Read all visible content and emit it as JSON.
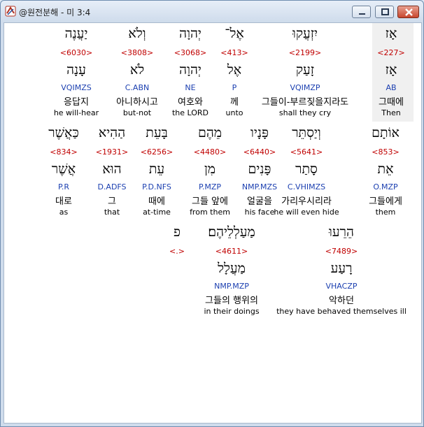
{
  "window": {
    "title": "@원전분해 - 미 3:4",
    "minimize": "minimize",
    "maximize": "maximize",
    "close": "close"
  },
  "rows": [
    {
      "words": [
        {
          "heb": "אָז",
          "strong": "<227>",
          "lemma": "אָז",
          "morph": "AB",
          "kor": "그때에",
          "eng": "Then"
        },
        {
          "heb": "יִזְעֲקוּ",
          "strong": "<2199>",
          "lemma": "זָעַק",
          "morph": "VQIMZP",
          "kor": "그들이-부르짖을지라도",
          "eng": "shall they cry"
        },
        {
          "heb": "אֶל־",
          "strong": "<413>",
          "lemma": "אֶל",
          "morph": "P",
          "kor": "께",
          "eng": "unto"
        },
        {
          "heb": "יְהוָה",
          "strong": "<3068>",
          "lemma": "יְהוָה",
          "morph": "NE",
          "kor": "여호와",
          "eng": "the LORD"
        },
        {
          "heb": "וְלֹא",
          "strong": "<3808>",
          "lemma": "לֹא",
          "morph": "C.ABN",
          "kor": "아니하시고",
          "eng": "but-not"
        },
        {
          "heb": "יַעֲנֶה",
          "strong": "<6030>",
          "lemma": "עָנָה",
          "morph": "VQIMZS",
          "kor": "응답지",
          "eng": "he will-hear"
        }
      ]
    },
    {
      "words": [
        {
          "heb": "אוֹתָם",
          "strong": "<853>",
          "lemma": "אֵת",
          "morph": "O.MZP",
          "kor": "그들에게",
          "eng": "them"
        },
        {
          "heb": "וְיַסְתֵּר",
          "strong": "<5641>",
          "lemma": "סָתַר",
          "morph": "C.VHIMZS",
          "kor": "가리우시리라",
          "eng": "he will even hide"
        },
        {
          "heb": "פָּנָיו",
          "strong": "<6440>",
          "lemma": "פָּנִים",
          "morph": "NMP.MZS",
          "kor": "얼굴을",
          "eng": "his face"
        },
        {
          "heb": "מֵהֶם",
          "strong": "<4480>",
          "lemma": "מִן",
          "morph": "P.MZP",
          "kor": "그들 앞에",
          "eng": "from them"
        },
        {
          "heb": "בָּעֵת",
          "strong": "<6256>",
          "lemma": "עֵת",
          "morph": "P.D.NFS",
          "kor": "때에",
          "eng": "at-time"
        },
        {
          "heb": "הַהִיא",
          "strong": "<1931>",
          "lemma": "הוּא",
          "morph": "D.ADFS",
          "kor": "그",
          "eng": "that"
        },
        {
          "heb": "כַּאֲשֶׁר",
          "strong": "<834>",
          "lemma": "אֲשֶׁר",
          "morph": "P.R",
          "kor": "대로",
          "eng": "as"
        }
      ]
    },
    {
      "words": [
        {
          "heb": "הֵרֵעוּ",
          "strong": "<7489>",
          "lemma": "רָעַע",
          "morph": "VHACZP",
          "kor": "악하던",
          "eng": "they have behaved themselves ill"
        },
        {
          "heb": "מַעַלְלֵיהֶם׃",
          "strong": "<4611>",
          "lemma": "מַעֲלָל",
          "morph": "NMP.MZP",
          "kor": "그들의 행위의",
          "eng": "in their doings"
        },
        {
          "heb": "פ",
          "strong": "<.>",
          "lemma": "",
          "morph": "",
          "kor": "",
          "eng": ""
        }
      ]
    }
  ]
}
